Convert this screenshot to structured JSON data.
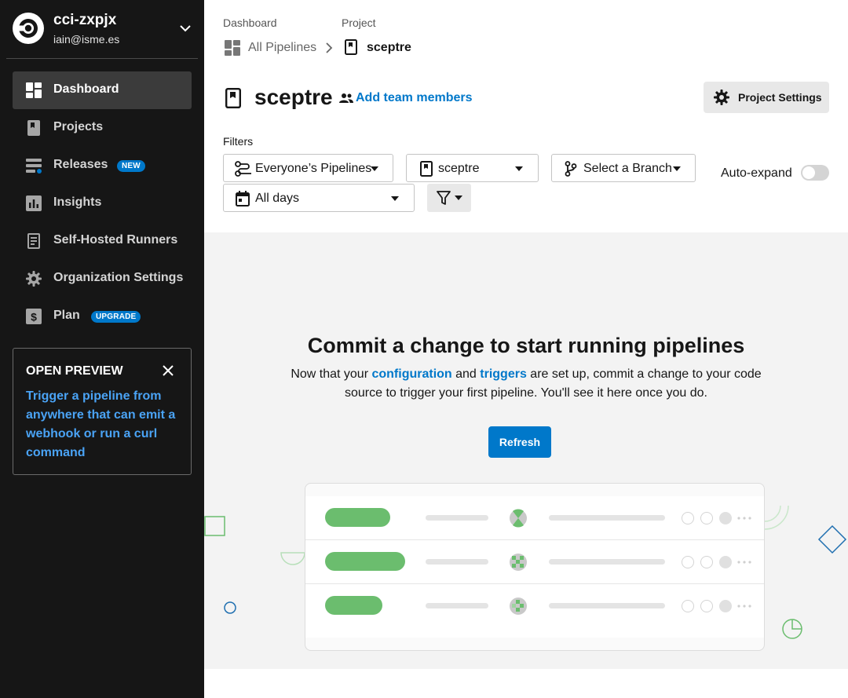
{
  "org": {
    "name": "cci-zxpjx",
    "email": "iain@isme.es"
  },
  "sidebar": {
    "items": [
      {
        "label": "Dashboard",
        "icon": "dashboard-icon",
        "active": true
      },
      {
        "label": "Projects",
        "icon": "projects-icon"
      },
      {
        "label": "Releases",
        "icon": "releases-icon",
        "badge": "NEW"
      },
      {
        "label": "Insights",
        "icon": "insights-icon"
      },
      {
        "label": "Self-Hosted Runners",
        "icon": "runners-icon"
      },
      {
        "label": "Organization Settings",
        "icon": "gear-icon"
      },
      {
        "label": "Plan",
        "icon": "plan-icon",
        "badge": "UPGRADE"
      }
    ]
  },
  "preview": {
    "title": "OPEN PREVIEW",
    "body": "Trigger a pipeline from anywhere that can emit a webhook or run a curl command"
  },
  "breadcrumb": {
    "dashboard_label": "Dashboard",
    "dashboard_value": "All Pipelines",
    "project_label": "Project",
    "project_value": "sceptre"
  },
  "header": {
    "title": "sceptre",
    "add_team": "Add team members",
    "project_settings": "Project Settings"
  },
  "filters": {
    "label": "Filters",
    "pipelines": "Everyone’s Pipelines",
    "project": "sceptre",
    "branch": "Select a Branch",
    "days": "All days",
    "auto_expand": "Auto-expand",
    "auto_expand_on": false
  },
  "empty": {
    "title": "Commit a change to start running pipelines",
    "desc_before": "Now that your ",
    "link_configuration": "configuration",
    "desc_and": " and ",
    "link_triggers": "triggers",
    "desc_after": " are set up, commit a change to your code source to trigger your first pipeline. You'll see it here once you do.",
    "refresh": "Refresh"
  },
  "colors": {
    "sidebar_bg": "#161616",
    "accent": "#0078ca",
    "link_light": "#4aa3f5",
    "success": "#6bbd6e"
  }
}
